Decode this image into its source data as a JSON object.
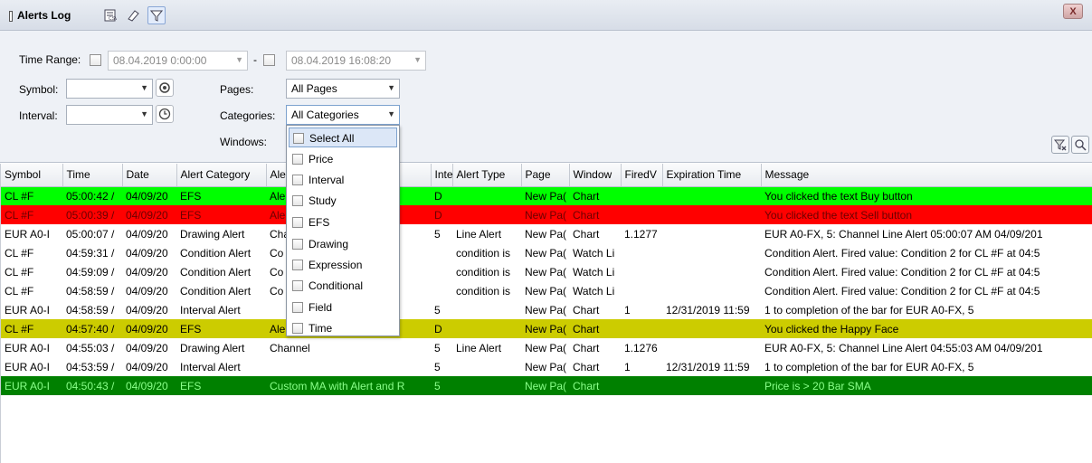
{
  "window": {
    "title": "Alerts Log",
    "close_label": "X"
  },
  "toolbar": {
    "icons": [
      "export-icon",
      "eraser-icon",
      "filter-icon"
    ]
  },
  "filters": {
    "time_range_label": "Time Range:",
    "time_from": "08.04.2019 0:00:00",
    "time_sep": "-",
    "time_to": "08.04.2019 16:08:20",
    "symbol_label": "Symbol:",
    "symbol_value": "",
    "interval_label": "Interval:",
    "interval_value": "",
    "pages_label": "Pages:",
    "pages_value": "All Pages",
    "categories_label": "Categories:",
    "categories_value": "All Categories",
    "windows_label": "Windows:"
  },
  "categories_dropdown": [
    "Select All",
    "Price",
    "Interval",
    "Study",
    "EFS",
    "Drawing",
    "Expression",
    "Conditional",
    "Field",
    "Time"
  ],
  "table": {
    "columns": [
      "Symbol",
      "Time",
      "Date",
      "Alert Category",
      "Ale",
      "Inte",
      "Alert Type",
      "Page",
      "Window",
      "FiredV",
      "Expiration Time",
      "Message"
    ],
    "rows": [
      {
        "style": "green",
        "cells": [
          "CL #F",
          "05:00:42 /",
          "04/09/20",
          "EFS",
          "Ale",
          "D",
          "",
          "New Pa(",
          "Chart",
          "",
          "",
          "You clicked the text Buy button"
        ]
      },
      {
        "style": "red",
        "cells": [
          "CL #F",
          "05:00:39 /",
          "04/09/20",
          "EFS",
          "Ale",
          "D",
          "",
          "New Pa(",
          "Chart",
          "",
          "",
          "You clicked the text Sell button"
        ]
      },
      {
        "style": "",
        "cells": [
          "EUR A0-I",
          "05:00:07 /",
          "04/09/20",
          "Drawing Alert",
          "Cha",
          "5",
          "Line Alert",
          "New Pa(",
          "Chart",
          "1.1277",
          "",
          "EUR A0-FX, 5: Channel Line Alert 05:00:07 AM 04/09/201"
        ]
      },
      {
        "style": "",
        "cells": [
          "CL #F",
          "04:59:31 /",
          "04/09/20",
          "Condition Alert",
          "Co",
          "",
          "condition is",
          "New Pa(",
          "Watch Li",
          "",
          "",
          "Condition Alert. Fired value: Condition 2 for CL #F at 04:5"
        ]
      },
      {
        "style": "",
        "cells": [
          "CL #F",
          "04:59:09 /",
          "04/09/20",
          "Condition Alert",
          "Co",
          "",
          "condition is",
          "New Pa(",
          "Watch Li",
          "",
          "",
          "Condition Alert. Fired value: Condition 2 for CL #F at 04:5"
        ]
      },
      {
        "style": "",
        "cells": [
          "CL #F",
          "04:58:59 /",
          "04/09/20",
          "Condition Alert",
          "Co",
          "",
          "condition is",
          "New Pa(",
          "Watch Li",
          "",
          "",
          "Condition Alert. Fired value: Condition 2 for CL #F at 04:5"
        ]
      },
      {
        "style": "",
        "cells": [
          "EUR A0-I",
          "04:58:59 /",
          "04/09/20",
          "Interval Alert",
          "",
          "5",
          "",
          "New Pa(",
          "Chart",
          "1",
          "12/31/2019 11:59",
          "1 to completion of the bar for EUR A0-FX, 5"
        ]
      },
      {
        "style": "olive",
        "cells": [
          "CL #F",
          "04:57:40 /",
          "04/09/20",
          "EFS",
          "Alert Buttons - CL #F, D",
          "D",
          "",
          "New Pa(",
          "Chart",
          "",
          "",
          "You clicked the Happy Face"
        ]
      },
      {
        "style": "",
        "cells": [
          "EUR A0-I",
          "04:55:03 /",
          "04/09/20",
          "Drawing Alert",
          "Channel",
          "5",
          "Line Alert",
          "New Pa(",
          "Chart",
          "1.1276",
          "",
          "EUR A0-FX, 5: Channel Line Alert 04:55:03 AM 04/09/201"
        ]
      },
      {
        "style": "",
        "cells": [
          "EUR A0-I",
          "04:53:59 /",
          "04/09/20",
          "Interval Alert",
          "",
          "5",
          "",
          "New Pa(",
          "Chart",
          "1",
          "12/31/2019 11:59",
          "1 to completion of the bar for EUR A0-FX, 5"
        ]
      },
      {
        "style": "dkgreen",
        "cells": [
          "EUR A0-I",
          "04:50:43 /",
          "04/09/20",
          "EFS",
          "Custom MA with Alert and R",
          "5",
          "",
          "New Pa(",
          "Chart",
          "",
          "",
          "Price is > 20 Bar SMA"
        ]
      }
    ]
  }
}
